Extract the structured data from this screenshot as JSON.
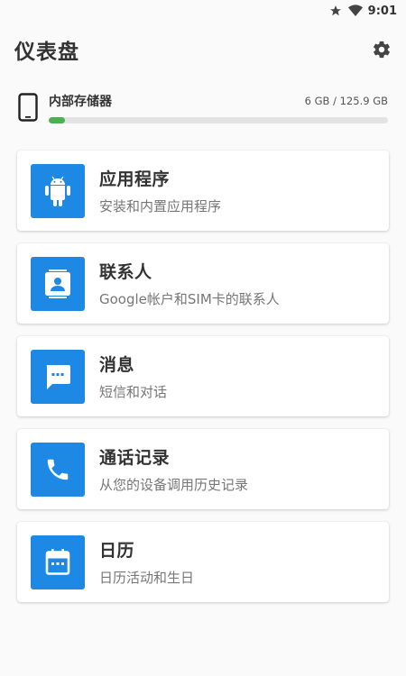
{
  "status_bar": {
    "time": "9:01",
    "icons": [
      "star-icon",
      "wifi-icon"
    ]
  },
  "app_bar": {
    "title": "仪表盘",
    "settings_icon": "gear-icon"
  },
  "storage": {
    "label": "内部存储器",
    "size": "6 GB / 125.9 GB",
    "used_fraction": 0.048,
    "bar_color": "#4caf50",
    "icon": "phone-icon"
  },
  "accent_color": "#1e88e5",
  "cards": [
    {
      "title": "应用程序",
      "subtitle": "安装和内置应用程序",
      "icon": "android-icon"
    },
    {
      "title": "联系人",
      "subtitle": "Google帐户和SIM卡的联系人",
      "icon": "contact-icon"
    },
    {
      "title": "消息",
      "subtitle": "短信和对话",
      "icon": "message-icon"
    },
    {
      "title": "通话记录",
      "subtitle": "从您的设备调用历史记录",
      "icon": "phone-call-icon"
    },
    {
      "title": "日历",
      "subtitle": "日历活动和生日",
      "icon": "calendar-icon"
    }
  ]
}
